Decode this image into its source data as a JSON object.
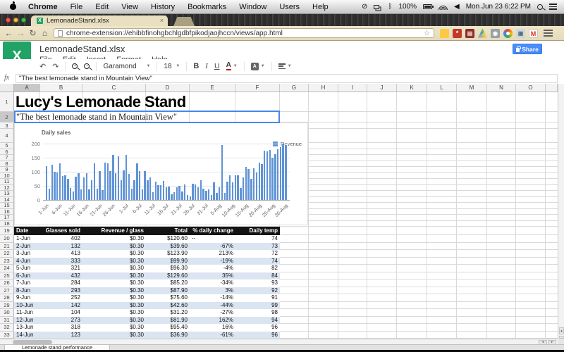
{
  "colors": {
    "accent_blue": "#4d90fe",
    "bar": "#6093d6",
    "row_alt": "#dbe5f1",
    "table_header_bg": "#141414",
    "excel_green": "#21a366",
    "selection": "#4a86e8"
  },
  "menubar": {
    "items": [
      "Chrome",
      "File",
      "Edit",
      "View",
      "History",
      "Bookmarks",
      "Window",
      "Users",
      "Help"
    ],
    "battery_pct": "100%",
    "clock": "Mon Jun 23  6:22 PM"
  },
  "browser": {
    "tab_title": "LemonadeStand.xlsx",
    "tab_close": "×",
    "favicon_letter": "X",
    "url": "chrome-extension://ehibbfinohgbchlgdbfpikodjaojhccn/views/app.html",
    "bookmark_star": "☆",
    "back": "←",
    "forward": "→",
    "reload": "↻",
    "home": "⌂",
    "extensions": [
      {
        "name": "extension-yellow-icon",
        "glyph": ""
      },
      {
        "name": "extension-red-star-icon",
        "glyph": "*"
      },
      {
        "name": "extension-book-icon",
        "glyph": "▤"
      },
      {
        "name": "drive-icon",
        "glyph": ""
      },
      {
        "name": "extension-gray-icon",
        "glyph": "◉"
      },
      {
        "name": "photos-icon",
        "glyph": ""
      },
      {
        "name": "screenshare-icon",
        "glyph": "▣"
      },
      {
        "name": "gmail-icon",
        "glyph": "M"
      }
    ]
  },
  "app": {
    "logo_letter": "X",
    "title": "LemonadeStand.xlsx",
    "menus": [
      "File",
      "Edit",
      "Insert",
      "Format",
      "Help"
    ],
    "share_label": "Share"
  },
  "toolbar": {
    "undo": "↶",
    "redo": "↷",
    "font": "Garamond",
    "size": "18",
    "bold": "B",
    "italic": "I",
    "underline": "U",
    "text_color": "A",
    "fill_letter": "A"
  },
  "formula_bar": {
    "fx": "fx",
    "value": "\"The best lemonade stand in Mountain View\""
  },
  "grid": {
    "columns": [
      "A",
      "B",
      "C",
      "D",
      "E",
      "F",
      "G",
      "H",
      "I",
      "J",
      "K",
      "L",
      "M",
      "N",
      "O"
    ],
    "row_count": 33,
    "a1": "Lucy's Lemonade Stand",
    "a2": "\"The best lemonade stand in Mountain View\""
  },
  "table": {
    "headers": [
      "Date",
      "Glasses sold",
      "Revenue / glass",
      "Total",
      "% daily change",
      "Daily temp"
    ],
    "rows": [
      [
        "1-Jun",
        "402",
        "$0.30",
        "$120.60",
        "--",
        "74"
      ],
      [
        "2-Jun",
        "132",
        "$0.30",
        "$39.60",
        "-67%",
        "73"
      ],
      [
        "3-Jun",
        "413",
        "$0.30",
        "$123.90",
        "213%",
        "72"
      ],
      [
        "4-Jun",
        "333",
        "$0.30",
        "$99.90",
        "-19%",
        "74"
      ],
      [
        "5-Jun",
        "321",
        "$0.30",
        "$96.30",
        "-4%",
        "82"
      ],
      [
        "6-Jun",
        "432",
        "$0.30",
        "$129.60",
        "35%",
        "84"
      ],
      [
        "7-Jun",
        "284",
        "$0.30",
        "$85.20",
        "-34%",
        "93"
      ],
      [
        "8-Jun",
        "293",
        "$0.30",
        "$87.90",
        "3%",
        "92"
      ],
      [
        "9-Jun",
        "252",
        "$0.30",
        "$75.60",
        "-14%",
        "91"
      ],
      [
        "10-Jun",
        "142",
        "$0.30",
        "$42.60",
        "-44%",
        "99"
      ],
      [
        "11-Jun",
        "104",
        "$0.30",
        "$31.20",
        "-27%",
        "98"
      ],
      [
        "12-Jun",
        "273",
        "$0.30",
        "$81.90",
        "162%",
        "94"
      ],
      [
        "13-Jun",
        "318",
        "$0.30",
        "$95.40",
        "16%",
        "96"
      ],
      [
        "14-Jun",
        "123",
        "$0.30",
        "$36.90",
        "-61%",
        "96"
      ]
    ]
  },
  "chart_data": {
    "type": "bar",
    "title": "Daily sales",
    "legend_position": "right",
    "x_range": [
      "1-Jun",
      "30-Aug"
    ],
    "xticklabels": [
      "1-Jun",
      "6-Jun",
      "11-Jun",
      "16-Jun",
      "21-Jun",
      "26-Jun",
      "1-Jul",
      "6-Jul",
      "11-Jul",
      "16-Jul",
      "21-Jul",
      "26-Jul",
      "31-Jul",
      "5-Aug",
      "10-Aug",
      "15-Aug",
      "20-Aug",
      "25-Aug",
      "30-Aug"
    ],
    "yticks": [
      0,
      50,
      100,
      150,
      200
    ],
    "ylim": [
      0,
      200
    ],
    "series": [
      {
        "name": "Revenue",
        "values": [
          120.6,
          39.6,
          123.9,
          99.9,
          96.3,
          129.6,
          85.2,
          87.9,
          75.6,
          42.6,
          31.2,
          81.9,
          95.4,
          36.9,
          81,
          96,
          38,
          70,
          130,
          41,
          102,
          35,
          133,
          130,
          102,
          160,
          95,
          154,
          71,
          105,
          160,
          93,
          40,
          69,
          129,
          103,
          38,
          102,
          70,
          80,
          27,
          65,
          52,
          53,
          68,
          46,
          48,
          20,
          27,
          45,
          50,
          30,
          56,
          17,
          13,
          58,
          56,
          46,
          70,
          41,
          33,
          38,
          17,
          63,
          24,
          46,
          195,
          25,
          65,
          88,
          63,
          87,
          88,
          42,
          80,
          117,
          110,
          75,
          113,
          97,
          132,
          128,
          175,
          172,
          177,
          150,
          163,
          180,
          187,
          200,
          195
        ]
      }
    ]
  },
  "sheetbar": {
    "tab": "Lemonade stand performance"
  }
}
